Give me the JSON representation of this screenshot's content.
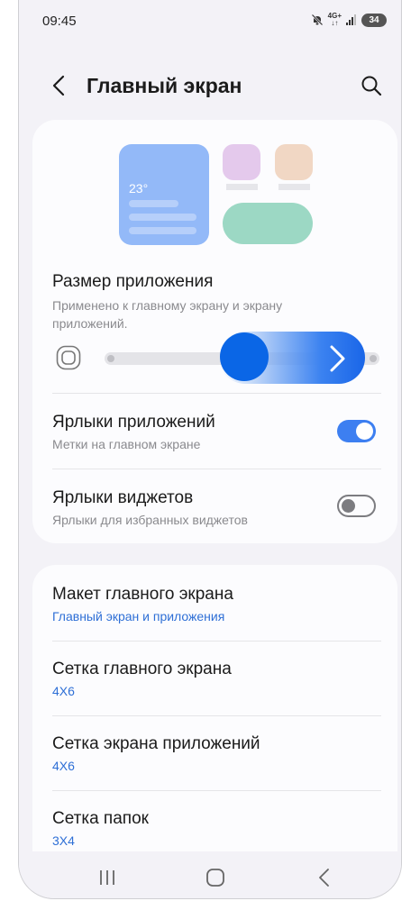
{
  "status_bar": {
    "time": "09:45",
    "network_top": "4G+",
    "network_bottom": "↓↑",
    "battery": "34"
  },
  "header": {
    "title": "Главный экран"
  },
  "preview": {
    "widget_temperature": "23°"
  },
  "app_size": {
    "title": "Размер приложения",
    "subtitle": "Применено к главному экрану и экрану приложений."
  },
  "app_labels": {
    "title": "Ярлыки приложений",
    "subtitle": "Метки на главном экране",
    "enabled": true
  },
  "widget_labels": {
    "title": "Ярлыки виджетов",
    "subtitle": "Ярлыки для избранных виджетов",
    "enabled": false
  },
  "layout_settings": [
    {
      "title": "Макет главного экрана",
      "value": "Главный экран и приложения"
    },
    {
      "title": "Сетка главного экрана",
      "value": "4X6"
    },
    {
      "title": "Сетка экрана приложений",
      "value": "4X6"
    },
    {
      "title": "Сетка папок",
      "value": "3X4"
    }
  ],
  "colors": {
    "accent": "#3d7ff1",
    "link_blue": "#2e6fd6",
    "slider_thumb": "#0a66e6"
  },
  "icons": {
    "back": "chevron-left-icon",
    "search": "search-icon",
    "app_size": "rounded-square-icon",
    "swipe_hint": "chevron-right-icon",
    "nav_recent": "recent-apps-icon",
    "nav_home": "home-icon",
    "nav_back": "back-icon"
  }
}
